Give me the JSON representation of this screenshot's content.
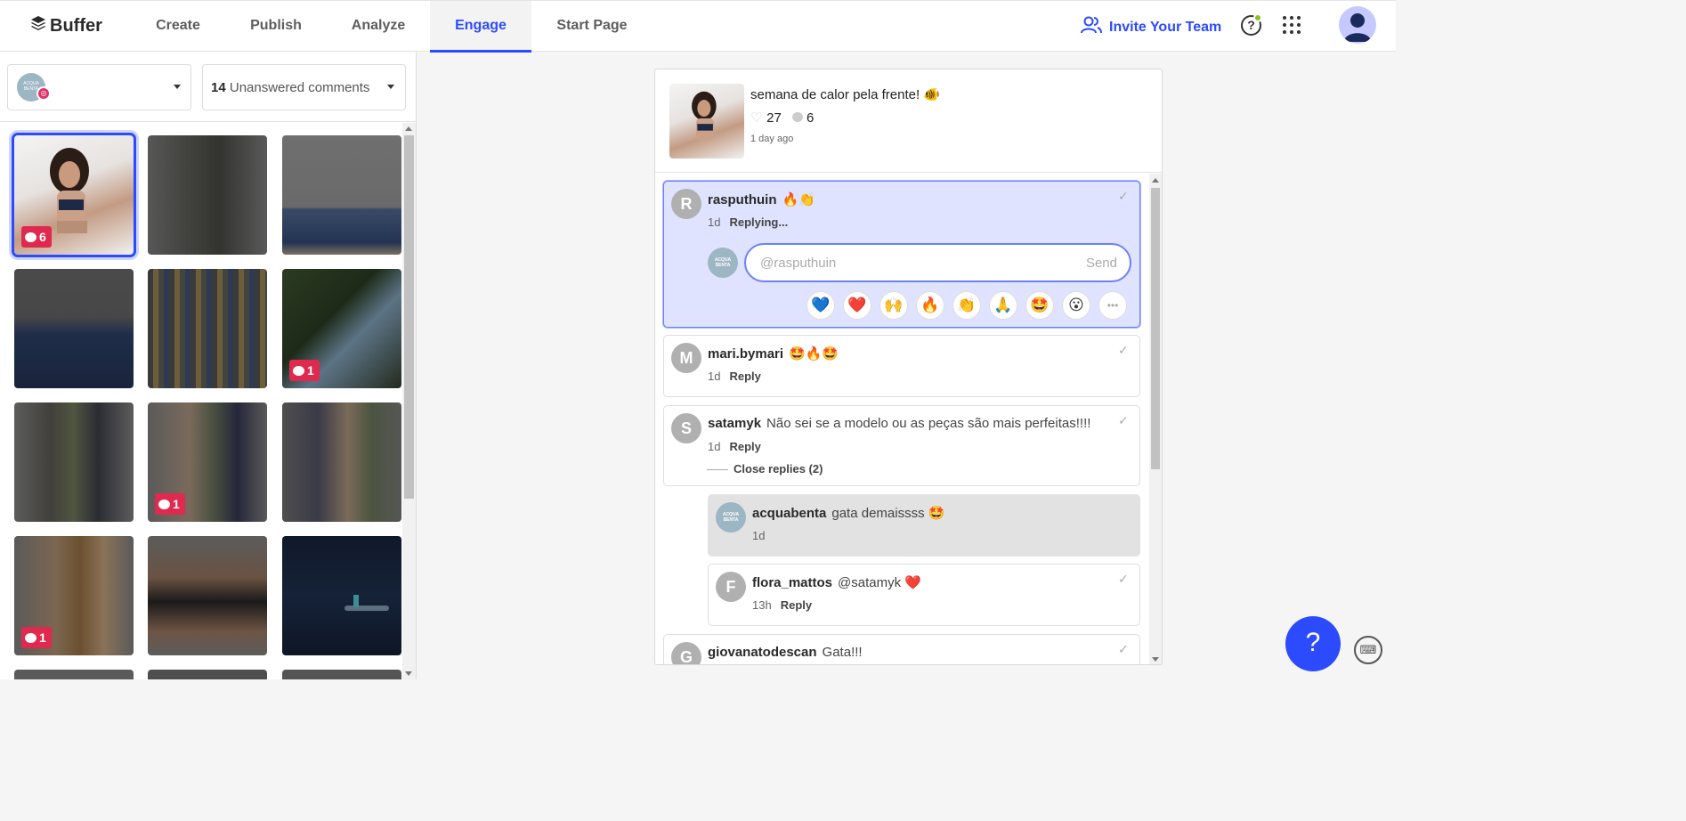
{
  "nav": {
    "brand": "Buffer",
    "tabs": [
      "Create",
      "Publish",
      "Analyze",
      "Engage",
      "Start Page"
    ],
    "active_tab": "Engage",
    "invite_label": "Invite Your Team",
    "help_label": "?"
  },
  "filters": {
    "account_name": "ACQUA BENTA",
    "unanswered_count": "14",
    "unanswered_label": "Unanswered comments"
  },
  "posts": [
    {
      "comments": "6",
      "selected": true
    },
    {
      "comments": ""
    },
    {
      "comments": ""
    },
    {
      "comments": ""
    },
    {
      "comments": ""
    },
    {
      "comments": "1"
    },
    {
      "comments": ""
    },
    {
      "comments": "1"
    },
    {
      "comments": ""
    },
    {
      "comments": "1"
    },
    {
      "comments": ""
    },
    {
      "comments": ""
    }
  ],
  "post": {
    "caption": "semana de calor pela frente! 🐠",
    "likes": "27",
    "comments": "6",
    "ago": "1 day ago"
  },
  "comments": [
    {
      "initial": "R",
      "user": "rasputhuin",
      "text": "🔥👏",
      "time": "1d",
      "action": "Replying..."
    },
    {
      "initial": "M",
      "user": "mari.bymari",
      "text": "🤩🔥🤩",
      "time": "1d",
      "action": "Reply"
    },
    {
      "initial": "S",
      "user": "satamyk",
      "text": "Não sei se a modelo ou as peças são mais perfeitas!!!!",
      "time": "1d",
      "action": "Reply",
      "close_replies": "Close replies (2)"
    },
    {
      "initial": "",
      "user": "acquabenta",
      "text": "gata demaissss 🤩",
      "time": "1d",
      "action": ""
    },
    {
      "initial": "F",
      "user": "flora_mattos",
      "text": "@satamyk ❤️",
      "time": "13h",
      "action": "Reply"
    },
    {
      "initial": "G",
      "user": "giovanatodescan",
      "text": "Gata!!!",
      "time": "",
      "action": ""
    }
  ],
  "reply": {
    "placeholder": "@rasputhuin",
    "send_label": "Send",
    "emojis": [
      "💙",
      "❤️",
      "🙌",
      "🔥",
      "👏",
      "🙏",
      "🤩",
      "😮",
      "•••"
    ]
  },
  "help_fab": "?"
}
